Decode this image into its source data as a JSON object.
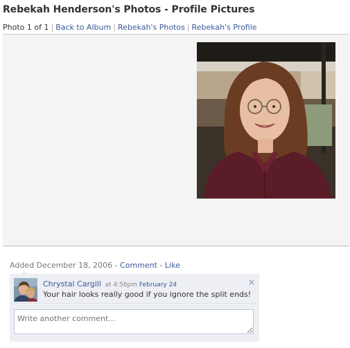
{
  "page": {
    "title": "Rebekah Henderson's Photos - Profile Pictures"
  },
  "nav": {
    "counter": "Photo 1 of 1",
    "links": [
      "Back to Album",
      "Rebekah's Photos",
      "Rebekah's Profile"
    ]
  },
  "photo_meta": {
    "added_prefix": "Added December 18, 2006 -",
    "comment_link": "Comment",
    "like_link": "Like"
  },
  "comments": [
    {
      "author": "Chrystal Cargill",
      "time_prefix": "at 4:56pm",
      "date_link": "February 24",
      "text": "Your hair looks really good if you ignore the split ends!"
    }
  ],
  "comment_input": {
    "placeholder": "Write another comment..."
  },
  "colors": {
    "link": "#3b5998",
    "comment_bg": "#edeff4"
  },
  "icons": {
    "close": "close-icon"
  }
}
